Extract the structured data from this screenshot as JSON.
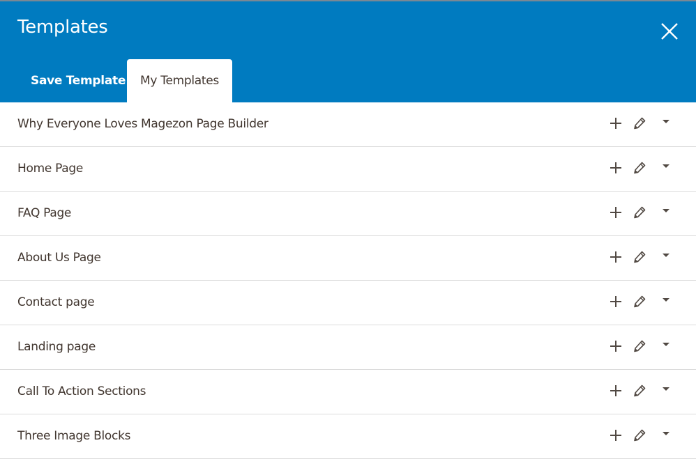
{
  "modal": {
    "title": "Templates",
    "close_icon": "close-icon"
  },
  "tabs": [
    {
      "label": "Save Template",
      "active": false
    },
    {
      "label": "My Templates",
      "active": true
    }
  ],
  "templates": [
    {
      "name": "Why Everyone Loves Magezon Page Builder"
    },
    {
      "name": "Home Page"
    },
    {
      "name": "FAQ Page"
    },
    {
      "name": "About Us Page"
    },
    {
      "name": "Contact page"
    },
    {
      "name": "Landing page"
    },
    {
      "name": "Call To Action Sections"
    },
    {
      "name": "Three Image Blocks"
    }
  ],
  "row_actions": [
    "plus-icon",
    "pencil-icon",
    "caret-down-icon"
  ],
  "colors": {
    "header": "#007bc0",
    "text": "#41362f",
    "icon": "#514943",
    "divider": "#dcdcdc"
  }
}
